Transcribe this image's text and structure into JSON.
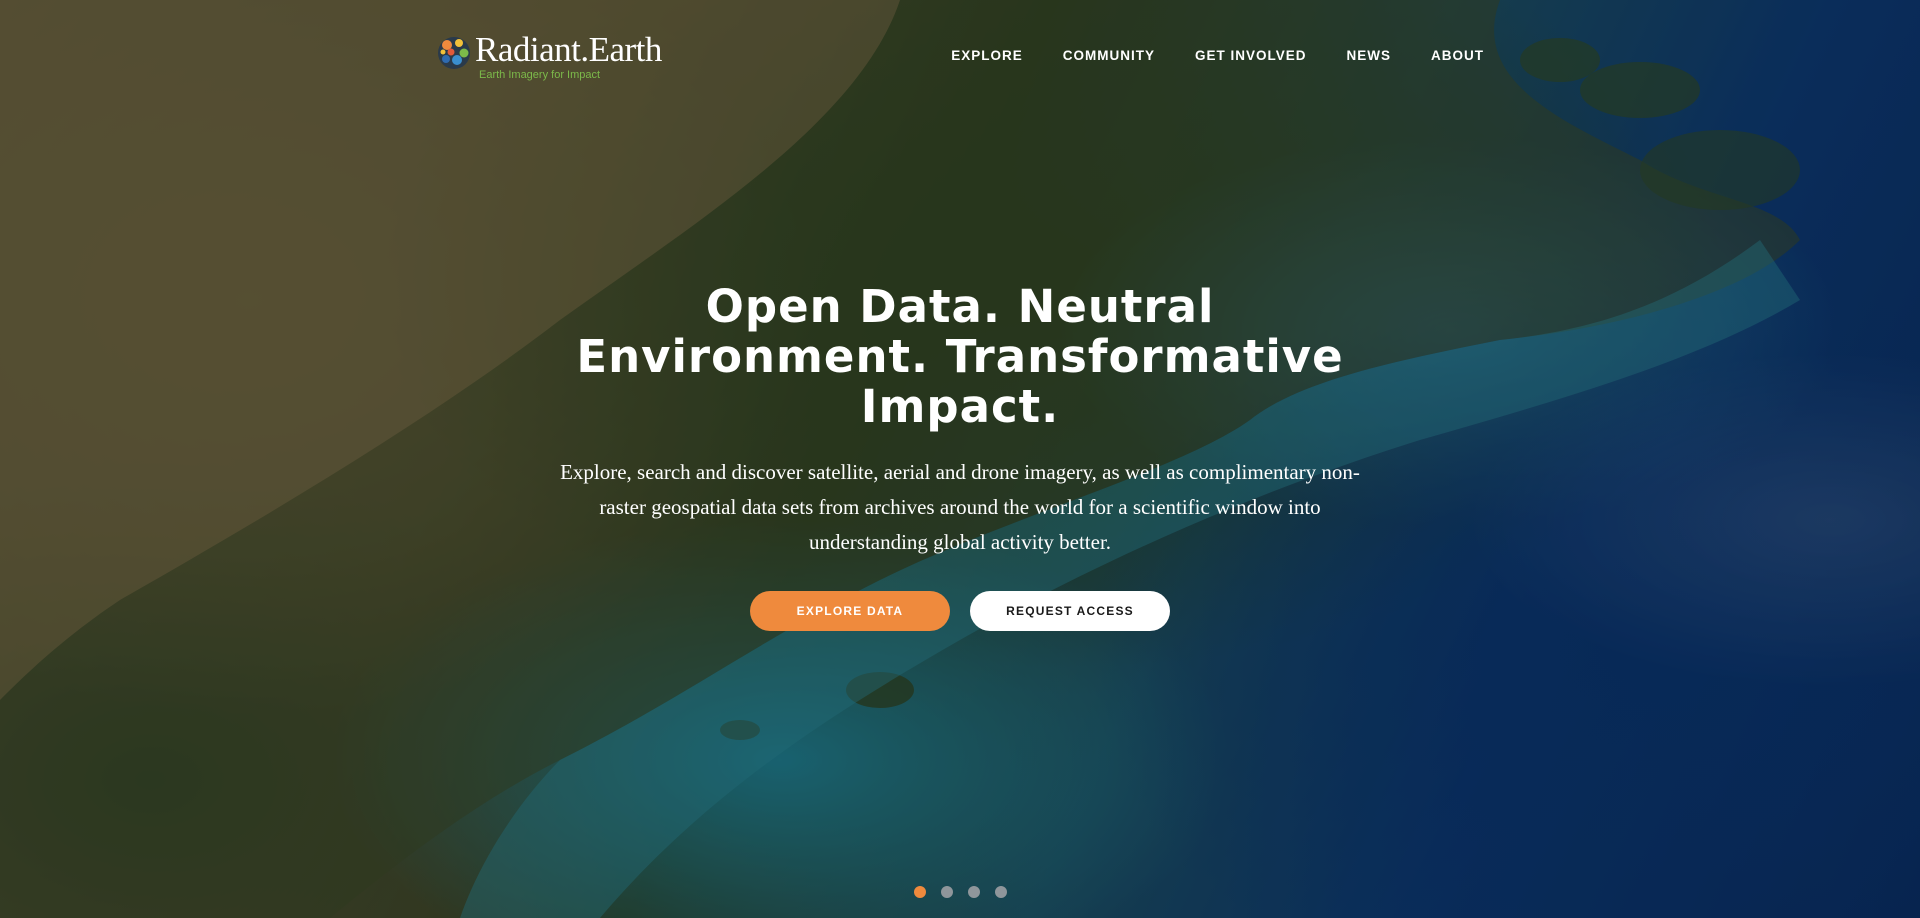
{
  "brand": {
    "name": "Radiant.Earth",
    "tagline": "Earth Imagery for Impact",
    "accent_color": "#ef8a3d",
    "tagline_color": "#7cba4a"
  },
  "nav": {
    "items": [
      {
        "label": "EXPLORE"
      },
      {
        "label": "COMMUNITY"
      },
      {
        "label": "GET INVOLVED"
      },
      {
        "label": "NEWS"
      },
      {
        "label": "ABOUT"
      }
    ]
  },
  "hero": {
    "title": "Open Data. Neutral Environment. Transformative Impact.",
    "subtitle": "Explore, search and discover satellite, aerial and drone imagery, as well as complimentary non-raster geospatial data sets from archives around the world for a scientific window into understanding global activity better.",
    "primary_cta": "EXPLORE DATA",
    "secondary_cta": "REQUEST ACCESS",
    "background": "satellite-imagery-coastline"
  },
  "carousel": {
    "slide_count": 4,
    "active_index": 0
  }
}
